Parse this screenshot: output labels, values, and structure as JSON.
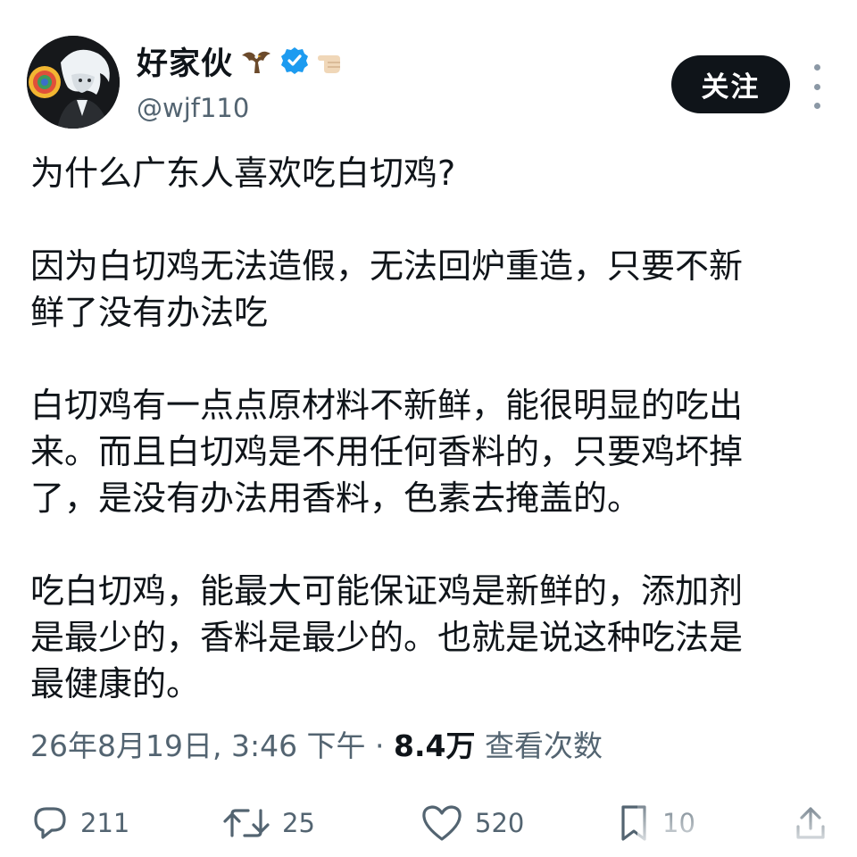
{
  "author": {
    "display_name": "好家伙",
    "handle": "@wjf110",
    "badges": [
      "eagle-icon",
      "verified-icon",
      "pointing-hand-icon"
    ],
    "verified_color": "#1d9bf0"
  },
  "header": {
    "follow_label": "关注",
    "more_icon": "more-vertical-icon"
  },
  "post": {
    "paragraphs": [
      "为什么广东人喜欢吃白切鸡?",
      "因为白切鸡无法造假，无法回炉重造，只要不新\n鲜了没有办法吃",
      "白切鸡有一点点原材料不新鲜，能很明显的吃出\n来。而且白切鸡是不用任何香料的，只要鸡坏掉\n了，是没有办法用香料，色素去掩盖的。",
      "吃白切鸡，能最大可能保证鸡是新鲜的，添加剂\n是最少的，香料是最少的。也就是说这种吃法是\n最健康的。"
    ]
  },
  "meta": {
    "timestamp": "26年8月19日, 3:46 下午",
    "separator": " · ",
    "views_count": "8.4万",
    "views_label": " 查看次数"
  },
  "actions": {
    "reply_count": "211",
    "repost_count": "25",
    "like_count": "520",
    "bookmark_count": "10"
  },
  "colors": {
    "text": "#0f1419",
    "secondary": "#536471",
    "button_bg": "#0f1419"
  }
}
